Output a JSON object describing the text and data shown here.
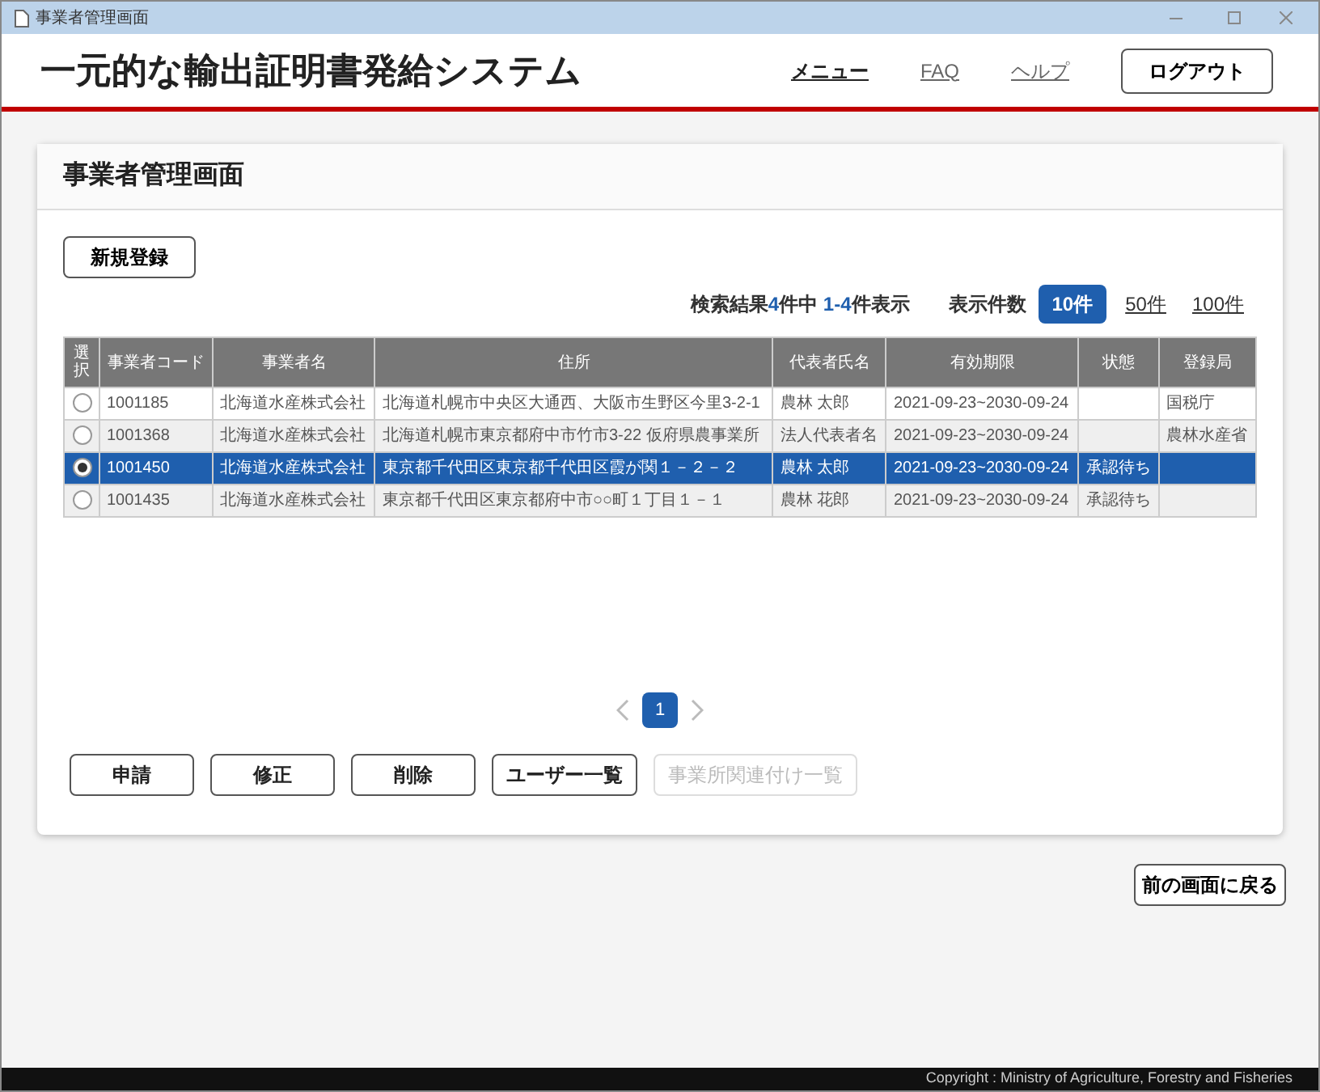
{
  "window": {
    "title": "事業者管理画面"
  },
  "header": {
    "app_title": "一元的な輸出証明書発給システム",
    "links": [
      "メニュー",
      "FAQ",
      "ヘルプ"
    ],
    "logout": "ログアウト"
  },
  "page": {
    "title": "事業者管理画面",
    "new_button": "新規登録",
    "result": {
      "prefix": "検索結果",
      "count": "4",
      "middle": "件中",
      "range": "1-4",
      "suffix": "件表示"
    },
    "page_size": {
      "label": "表示件数",
      "options": [
        {
          "label": "10件",
          "selected": true
        },
        {
          "label": "50件",
          "selected": false
        },
        {
          "label": "100件",
          "selected": false
        }
      ]
    },
    "table": {
      "select_header": "選択",
      "columns": [
        "事業者コード",
        "事業者名",
        "住所",
        "代表者氏名",
        "有効期限",
        "状態",
        "登録局"
      ],
      "rows": [
        {
          "selected": false,
          "cells": [
            "1001185",
            "北海道水産株式会社",
            "北海道札幌市中央区大通西、大阪市生野区今里3-2-1",
            "農林 太郎",
            "2021-09-23~2030-09-24",
            "",
            "国税庁"
          ]
        },
        {
          "selected": false,
          "cells": [
            "1001368",
            "北海道水産株式会社",
            "北海道札幌市東京都府中市竹市3-22 仮府県農事業所",
            "法人代表者名",
            "2021-09-23~2030-09-24",
            "",
            "農林水産省"
          ]
        },
        {
          "selected": true,
          "cells": [
            "1001450",
            "北海道水産株式会社",
            "東京都千代田区東京都千代田区霞が関１－２－２",
            "農林 太郎",
            "2021-09-23~2030-09-24",
            "承認待ち",
            ""
          ]
        },
        {
          "selected": false,
          "cells": [
            "1001435",
            "北海道水産株式会社",
            "東京都千代田区東京都府中市○○町１丁目１－１",
            "農林 花郎",
            "2021-09-23~2030-09-24",
            "承認待ち",
            ""
          ]
        }
      ]
    },
    "pagination": {
      "pages": [
        {
          "label": "1",
          "selected": true
        }
      ]
    },
    "actions": [
      {
        "label": "申請",
        "disabled": false
      },
      {
        "label": "修正",
        "disabled": false
      },
      {
        "label": "削除",
        "disabled": false
      },
      {
        "label": "ユーザー一覧",
        "disabled": false
      },
      {
        "label": "事業所関連付け一覧",
        "disabled": true
      }
    ]
  },
  "back_button": "前の画面に戻る",
  "footer": "Copyright : Ministry of Agriculture, Forestry and Fisheries"
}
